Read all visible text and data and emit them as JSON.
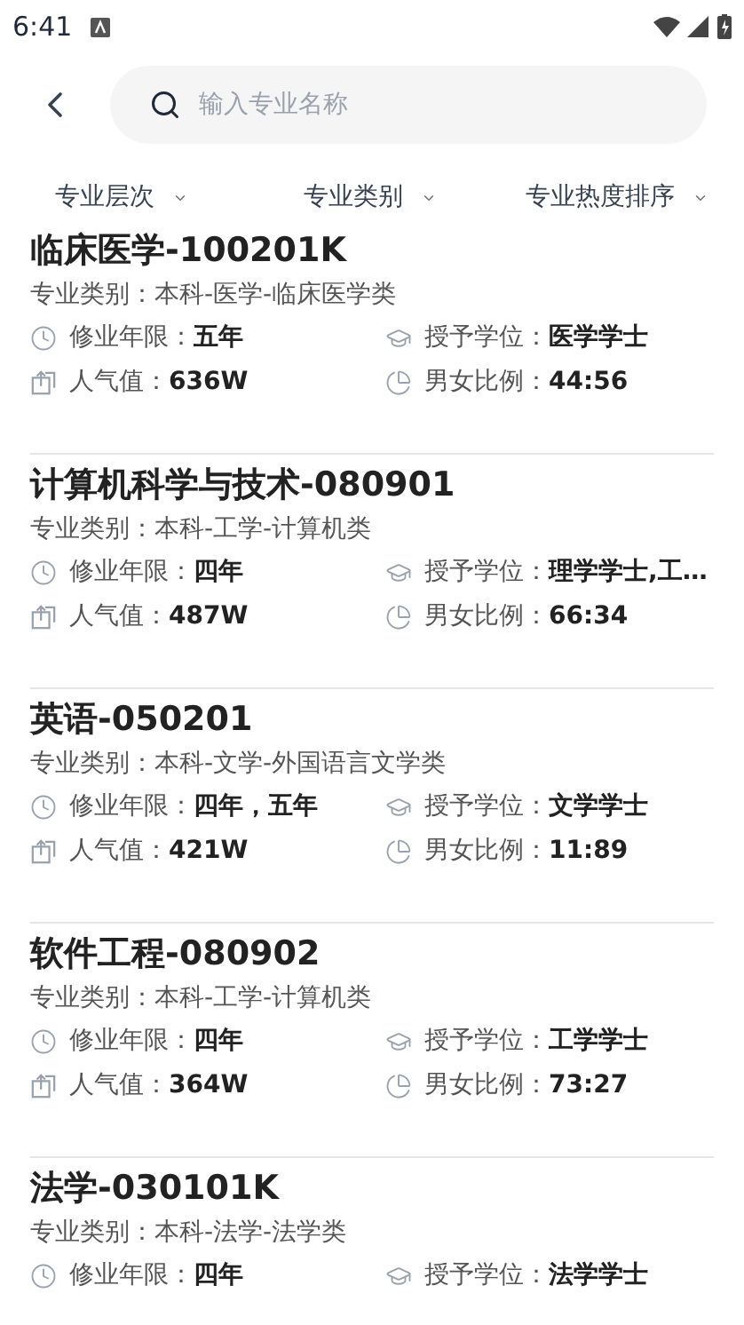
{
  "status_bar": {
    "time": "6:41"
  },
  "search": {
    "placeholder": "输入专业名称"
  },
  "filters": [
    {
      "label": "专业层次"
    },
    {
      "label": "专业类别"
    },
    {
      "label": "专业热度排序"
    }
  ],
  "majors": [
    {
      "title": "临床医学-100201K",
      "category": "专业类别：本科-医学-临床医学类",
      "fields": [
        {
          "kind": "duration",
          "text": "修业年限：**五年**"
        },
        {
          "kind": "degree",
          "text": "授予学位：**医学学士**"
        },
        {
          "kind": "popularity",
          "text": "人气值：**636W**"
        },
        {
          "kind": "ratio",
          "text": "男女比例：**44:56**"
        }
      ]
    },
    {
      "title": "计算机科学与技术-080901",
      "category": "专业类别：本科-工学-计算机类",
      "fields": [
        {
          "kind": "duration",
          "text": "修业年限：**四年**"
        },
        {
          "kind": "degree",
          "text": "授予学位：**理学学士,工…**"
        },
        {
          "kind": "popularity",
          "text": "人气值：**487W**"
        },
        {
          "kind": "ratio",
          "text": "男女比例：**66:34**"
        }
      ]
    },
    {
      "title": "英语-050201",
      "category": "专业类别：本科-文学-外国语言文学类",
      "fields": [
        {
          "kind": "duration",
          "text": "修业年限：**四年，五年**"
        },
        {
          "kind": "degree",
          "text": "授予学位：**文学学士**"
        },
        {
          "kind": "popularity",
          "text": "人气值：**421W**"
        },
        {
          "kind": "ratio",
          "text": "男女比例：**11:89**"
        }
      ]
    },
    {
      "title": "软件工程-080902",
      "category": "专业类别：本科-工学-计算机类",
      "fields": [
        {
          "kind": "duration",
          "text": "修业年限：**四年**"
        },
        {
          "kind": "degree",
          "text": "授予学位：**工学学士**"
        },
        {
          "kind": "popularity",
          "text": "人气值：**364W**"
        },
        {
          "kind": "ratio",
          "text": "男女比例：**73:27**"
        }
      ]
    },
    {
      "title": "法学-030101K",
      "category": "专业类别：本科-法学-法学类",
      "fields": [
        {
          "kind": "duration",
          "text": "修业年限：**四年**"
        },
        {
          "kind": "degree",
          "text": "授予学位：**法学学士**"
        }
      ]
    }
  ]
}
